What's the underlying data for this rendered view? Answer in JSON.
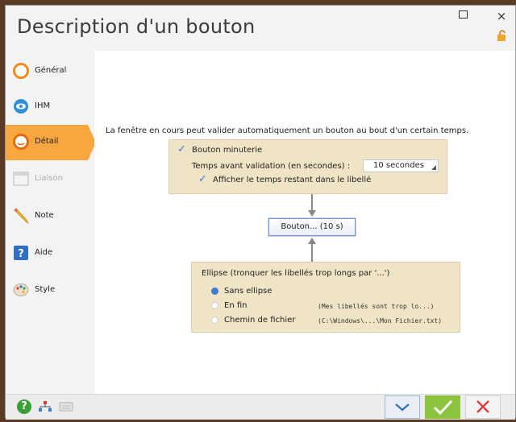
{
  "window": {
    "title": "Description d'un bouton",
    "maximize_glyph": "",
    "close_glyph": "×"
  },
  "sidebar": {
    "items": [
      {
        "label": "Général",
        "icon": "general-icon"
      },
      {
        "label": "IHM",
        "icon": "eye-icon"
      },
      {
        "label": "Détail",
        "icon": "detail-icon",
        "active": true
      },
      {
        "label": "Liaison",
        "icon": "link-icon",
        "disabled": true
      },
      {
        "label": "Note",
        "icon": "pencil-icon"
      },
      {
        "label": "Aide",
        "icon": "help-book-icon"
      },
      {
        "label": "Style",
        "icon": "palette-icon"
      }
    ]
  },
  "detail": {
    "intro": "La fenêtre en cours peut valider automatiquement un bouton au bout d'un certain temps.",
    "timer_checkbox": "Bouton minuterie",
    "delay_label": "Temps avant validation (en secondes) :",
    "delay_value": "10 secondes",
    "show_remaining": "Afficher le temps restant dans le libellé",
    "preview_button": "Bouton... (10 s)",
    "ellipsis_title": "Ellipse (tronquer les libellés trop longs par '...')",
    "ellipsis_options": [
      {
        "label": "Sans ellipse",
        "selected": true,
        "hint": ""
      },
      {
        "label": "En fin",
        "selected": false,
        "hint": "(Mes libellés sont trop lo...)"
      },
      {
        "label": "Chemin de fichier",
        "selected": false,
        "hint": "(C:\\Windows\\...\\Mon Fichier.txt)"
      }
    ]
  },
  "bottom": {
    "help_glyph": "?",
    "ok_glyph": "✓",
    "cancel_glyph": "✕",
    "down_glyph": "⌄"
  },
  "colors": {
    "accent_active": "#f7a640",
    "panel": "#efe4c6",
    "ok": "#8bc53f",
    "cancel": "#e03c3c",
    "check_blue": "#3a7bd5"
  }
}
